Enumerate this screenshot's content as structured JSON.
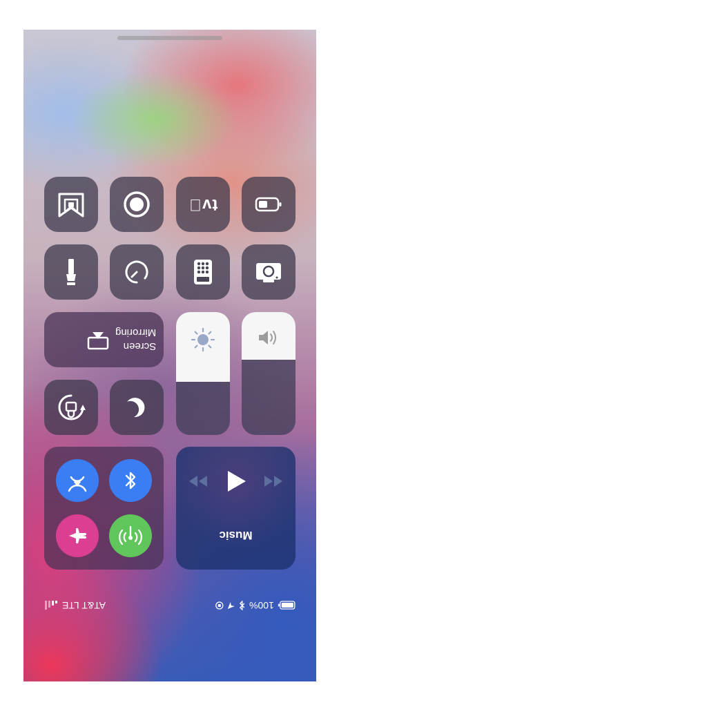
{
  "window": {
    "title": "Control Center"
  },
  "tiles": {
    "guided_access": {
      "icon": "guided-access-shield-icon"
    },
    "screen_recording": {
      "icon": "record-icon"
    },
    "apple_tv_remote": {
      "icon": "apple-tv-icon",
      "label": "tv"
    },
    "low_power_mode": {
      "icon": "battery-icon"
    },
    "flashlight": {
      "icon": "flashlight-icon"
    },
    "timer": {
      "icon": "timer-icon"
    },
    "calculator": {
      "icon": "calculator-icon"
    },
    "camera": {
      "icon": "camera-icon"
    },
    "screen_mirroring": {
      "icon": "screen-mirroring-icon",
      "label_line1": "Screen",
      "label_line2": "Mirroring"
    },
    "orientation_lock": {
      "icon": "orientation-lock-icon"
    },
    "do_not_disturb": {
      "icon": "moon-icon"
    }
  },
  "sliders": {
    "brightness": {
      "icon": "sun-icon",
      "level": 0.57
    },
    "volume": {
      "icon": "speaker-icon",
      "level": 0.39
    }
  },
  "connectivity": {
    "airdrop": {
      "icon": "airdrop-icon",
      "color": "#3b7ef4"
    },
    "bluetooth": {
      "icon": "bluetooth-icon",
      "color": "#3b7ef4"
    },
    "airplane_mode": {
      "icon": "airplane-icon",
      "color": "#dc3f91"
    },
    "cellular_data": {
      "icon": "cellular-antenna-icon",
      "color": "#60c65c"
    }
  },
  "music": {
    "title": "Music",
    "controls": {
      "previous": "rewind-icon",
      "play": "play-icon",
      "next": "fast-forward-icon"
    }
  },
  "status_bar": {
    "carrier": "AT&T LTE",
    "battery_percent": "100%",
    "icons": [
      "signal-bars-icon",
      "orientation-lock-icon",
      "location-arrow-icon",
      "bluetooth-icon",
      "battery-icon"
    ]
  }
}
